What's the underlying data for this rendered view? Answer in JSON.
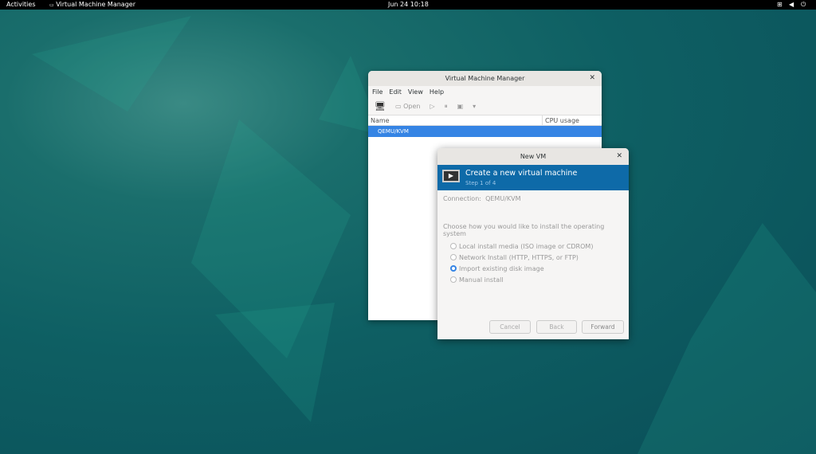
{
  "topbar": {
    "activities": "Activities",
    "app": "Virtual Machine Manager",
    "clock": "Jun 24  10:18"
  },
  "main_window": {
    "title": "Virtual Machine Manager",
    "menu": [
      "File",
      "Edit",
      "View",
      "Help"
    ],
    "toolbar": {
      "open": "Open"
    },
    "columns": {
      "name": "Name",
      "cpu": "CPU usage"
    },
    "rows": [
      "QEMU/KVM"
    ]
  },
  "dialog": {
    "title": "New VM",
    "heading": "Create a new virtual machine",
    "step": "Step 1 of 4",
    "connection_label": "Connection:",
    "connection_value": "QEMU/KVM",
    "prompt": "Choose how you would like to install the operating system",
    "options": [
      {
        "label": "Local install media (ISO image or CDROM)",
        "selected": false
      },
      {
        "label": "Network Install (HTTP, HTTPS, or FTP)",
        "selected": false
      },
      {
        "label": "Import existing disk image",
        "selected": true
      },
      {
        "label": "Manual install",
        "selected": false
      }
    ],
    "buttons": {
      "cancel": "Cancel",
      "back": "Back",
      "forward": "Forward"
    }
  }
}
